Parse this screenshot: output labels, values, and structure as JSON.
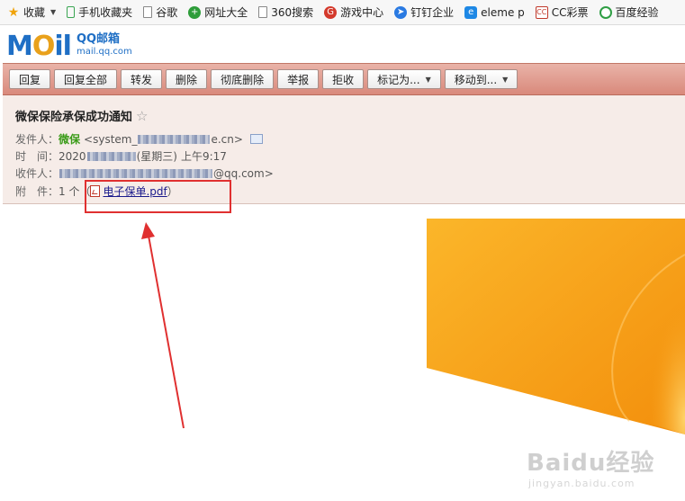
{
  "bookmarks": [
    {
      "label": "收藏",
      "icon": "star-icon",
      "color": "#f0a30a",
      "dropdown": true
    },
    {
      "label": "手机收藏夹",
      "icon": "phone-icon",
      "color": "#3aa552"
    },
    {
      "label": "谷歌",
      "icon": "page-icon",
      "color": "#888888"
    },
    {
      "label": "网址大全",
      "icon": "globe-plus-icon",
      "color": "#2e9d3a"
    },
    {
      "label": "360搜索",
      "icon": "page-icon",
      "color": "#888888"
    },
    {
      "label": "游戏中心",
      "icon": "game-icon",
      "color": "#d43a2c"
    },
    {
      "label": "钉钉企业",
      "icon": "dingtalk-icon",
      "color": "#2a7ae2"
    },
    {
      "label": "eleme p",
      "icon": "eleme-icon",
      "color": "#1e88e5"
    },
    {
      "label": "CC彩票",
      "icon": "lottery-icon",
      "color": "#c0392b"
    },
    {
      "label": "百度经验",
      "icon": "baidu-jingyan-icon",
      "color": "#2f9e44"
    }
  ],
  "logo": {
    "word": "MOil",
    "qq_title": "QQ邮箱",
    "qq_domain": "mail.qq.com"
  },
  "toolbar": {
    "reply": "回复",
    "reply_all": "回复全部",
    "forward": "转发",
    "delete": "删除",
    "delete_permanent": "彻底删除",
    "report": "举报",
    "reject": "拒收",
    "mark_as": "标记为...",
    "move_to": "移动到..."
  },
  "mail": {
    "subject": "微保保险承保成功通知",
    "sender_label": "发件人：",
    "sender_name": "微保",
    "sender_email_prefix": "<system_",
    "sender_email_suffix": "e.cn>",
    "time_label": "时　间：",
    "time_prefix": "2020",
    "time_weekday": "(星期三)",
    "time_value": "上午9:17",
    "recipient_label": "收件人：",
    "recipient_suffix": "@qq.com>",
    "attach_label": "附　件：",
    "attach_count": "1 个（",
    "attach_file": "电子保单.pdf",
    "attach_close": "）"
  },
  "watermark": {
    "brand": "Baidu经验",
    "site": "jingyan.baidu.com"
  },
  "colors": {
    "toolbar": "#d9897b",
    "header_bg": "#f6ece8",
    "annotation": "#e03030",
    "orange": "#f7a11a"
  }
}
